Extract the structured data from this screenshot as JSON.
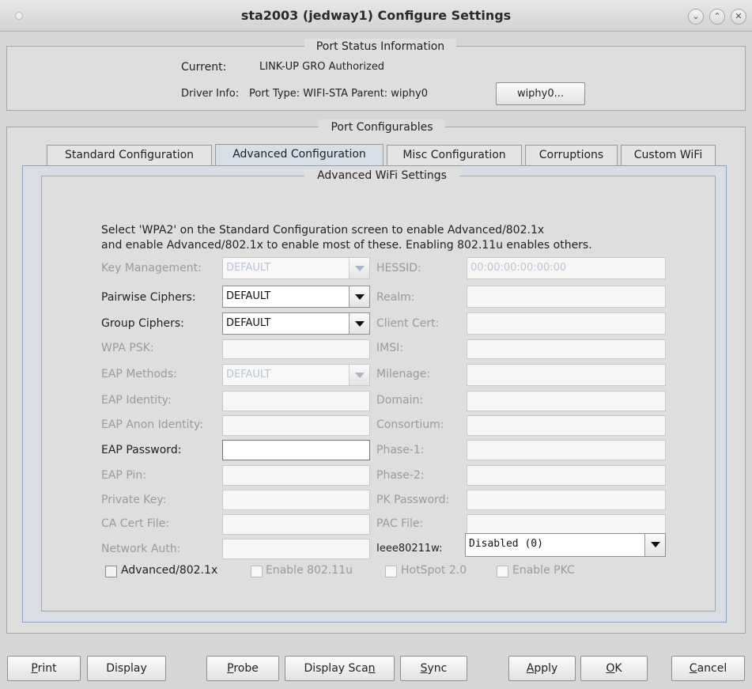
{
  "window": {
    "title": "sta2003  (jedway1) Configure Settings",
    "controls": [
      "minimize-icon",
      "maximize-icon",
      "close-icon"
    ]
  },
  "port_status": {
    "legend": "Port Status Information",
    "current_label": "Current:",
    "current_value": "LINK-UP GRO  Authorized",
    "driver_label": "Driver Info:",
    "driver_value": "Port Type: WIFI-STA   Parent: wiphy0",
    "wiphy_button": "wiphy0..."
  },
  "configurables": {
    "legend": "Port Configurables",
    "tabs": [
      {
        "label": "Standard Configuration",
        "active": false
      },
      {
        "label": "Advanced Configuration",
        "active": true
      },
      {
        "label": "Misc Configuration",
        "active": false
      },
      {
        "label": "Corruptions",
        "active": false
      },
      {
        "label": "Custom WiFi",
        "active": false
      }
    ]
  },
  "advanced": {
    "legend": "Advanced WiFi Settings",
    "help_line1": "Select 'WPA2' on the Standard Configuration screen to enable Advanced/802.1x",
    "help_line2": "and enable Advanced/802.1x to enable most of these. Enabling 802.11u enables others.",
    "left_fields": [
      {
        "label": "Key Management:",
        "type": "combo",
        "value": "DEFAULT",
        "enabled": false
      },
      {
        "label": "Pairwise Ciphers:",
        "type": "combo",
        "value": "DEFAULT",
        "enabled": true
      },
      {
        "label": "Group Ciphers:",
        "type": "combo",
        "value": "DEFAULT",
        "enabled": true
      },
      {
        "label": "WPA PSK:",
        "type": "text",
        "value": "",
        "enabled": false
      },
      {
        "label": "EAP Methods:",
        "type": "combo",
        "value": "DEFAULT",
        "enabled": false
      },
      {
        "label": "EAP Identity:",
        "type": "text",
        "value": "",
        "enabled": false
      },
      {
        "label": "EAP Anon Identity:",
        "type": "text",
        "value": "",
        "enabled": false
      },
      {
        "label": "EAP Password:",
        "type": "text",
        "value": "",
        "enabled": true
      },
      {
        "label": "EAP Pin:",
        "type": "text",
        "value": "",
        "enabled": false
      },
      {
        "label": "Private Key:",
        "type": "text",
        "value": "",
        "enabled": false
      },
      {
        "label": "CA Cert File:",
        "type": "text",
        "value": "",
        "enabled": false
      },
      {
        "label": "Network Auth:",
        "type": "text",
        "value": "",
        "enabled": false
      }
    ],
    "right_fields": [
      {
        "label": "HESSID:",
        "type": "text",
        "value": "00:00:00:00:00:00",
        "enabled": false
      },
      {
        "label": "Realm:",
        "type": "text",
        "value": "",
        "enabled": false
      },
      {
        "label": "Client Cert:",
        "type": "text",
        "value": "",
        "enabled": false
      },
      {
        "label": "IMSI:",
        "type": "text",
        "value": "",
        "enabled": false
      },
      {
        "label": "Milenage:",
        "type": "text",
        "value": "",
        "enabled": false
      },
      {
        "label": "Domain:",
        "type": "text",
        "value": "",
        "enabled": false
      },
      {
        "label": "Consortium:",
        "type": "text",
        "value": "",
        "enabled": false
      },
      {
        "label": "Phase-1:",
        "type": "text",
        "value": "",
        "enabled": false
      },
      {
        "label": "Phase-2:",
        "type": "text",
        "value": "",
        "enabled": false
      },
      {
        "label": "PK Password:",
        "type": "text",
        "value": "",
        "enabled": false
      },
      {
        "label": "PAC File:",
        "type": "text",
        "value": "",
        "enabled": false
      },
      {
        "label": "Ieee80211w:",
        "type": "combo",
        "value": "Disabled (0)",
        "enabled": true
      }
    ],
    "checkboxes": [
      {
        "label": "Advanced/802.1x",
        "checked": false,
        "enabled": true
      },
      {
        "label": "Enable 802.11u",
        "checked": false,
        "enabled": false
      },
      {
        "label": "HotSpot 2.0",
        "checked": false,
        "enabled": false
      },
      {
        "label": "Enable PKC",
        "checked": false,
        "enabled": false
      }
    ]
  },
  "buttons": {
    "print": "Print",
    "display": "Display",
    "probe": "Probe",
    "display_scan": "Display Scan",
    "sync": "Sync",
    "apply": "Apply",
    "ok": "OK",
    "cancel": "Cancel"
  }
}
